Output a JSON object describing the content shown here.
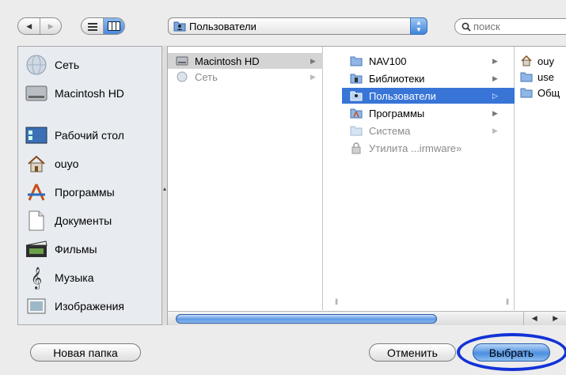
{
  "toolbar": {
    "back_icon": "back-arrow-icon",
    "forward_icon": "forward-arrow-icon",
    "list_view_icon": "list-view-icon",
    "column_view_icon": "column-view-icon",
    "location": "Пользователи",
    "search_placeholder": "поиск"
  },
  "sidebar": {
    "items": [
      {
        "label": "Сеть",
        "icon": "network-icon"
      },
      {
        "label": "Macintosh HD",
        "icon": "hard-drive-icon"
      },
      {
        "label": "Рабочий стол",
        "icon": "desktop-icon"
      },
      {
        "label": "ouyo",
        "icon": "home-icon"
      },
      {
        "label": "Программы",
        "icon": "applications-icon"
      },
      {
        "label": "Документы",
        "icon": "documents-icon"
      },
      {
        "label": "Фильмы",
        "icon": "movies-icon"
      },
      {
        "label": "Музыка",
        "icon": "music-icon"
      },
      {
        "label": "Изображения",
        "icon": "pictures-icon"
      }
    ]
  },
  "columns": {
    "col1": [
      {
        "label": "Macintosh HD",
        "state": "selected-inactive"
      },
      {
        "label": "Сеть",
        "state": "dim"
      }
    ],
    "col2": [
      {
        "label": "NAV100",
        "state": "normal"
      },
      {
        "label": "Библиотеки",
        "state": "normal"
      },
      {
        "label": "Пользователи",
        "state": "selected"
      },
      {
        "label": "Программы",
        "state": "normal"
      },
      {
        "label": "Система",
        "state": "dim"
      },
      {
        "label": "Утилита ...irmware»",
        "state": "dim"
      }
    ],
    "col3": [
      {
        "label": "ouy"
      },
      {
        "label": "use"
      },
      {
        "label": "Общ"
      }
    ]
  },
  "buttons": {
    "new_folder": "Новая папка",
    "cancel": "Отменить",
    "choose": "Выбрать"
  },
  "colors": {
    "selection": "#3875d7",
    "highlight_ring": "#1232d6"
  }
}
